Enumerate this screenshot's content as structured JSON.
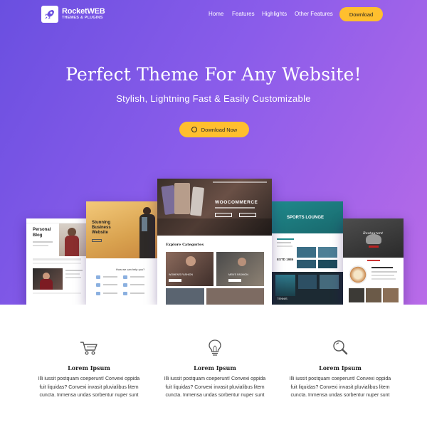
{
  "brand": {
    "name": "RocketWEB",
    "tagline": "THEMES & PLUGINS",
    "logo_icon": "rocket-icon"
  },
  "nav": {
    "items": [
      "Home",
      "Features",
      "Highlights",
      "Other Features"
    ],
    "cta_label": "Download"
  },
  "hero": {
    "title": "Perfect Theme For Any Website!",
    "subtitle": "Stylish, Lightning Fast & Easily Customizable",
    "cta_label": "Download Now",
    "cta_icon": "wordpress-icon"
  },
  "previews": {
    "personal": {
      "title_line1": "Personal",
      "title_line2": "Blog"
    },
    "business": {
      "title_line1": "Stunning",
      "title_line2": "Business",
      "title_line3": "Website",
      "help": "How we can help you?"
    },
    "woo": {
      "title": "WOOCOMMERCE",
      "section": "Explore Categories",
      "cat1": "WOMEN'S FASHION",
      "cat2": "MEN'S FASHION"
    },
    "sports": {
      "title": "SPORTS LOUNGE",
      "est": "ESTD 1986",
      "tennis": "TENNIS"
    },
    "restaurant": {
      "title": "Restaurant"
    }
  },
  "features": [
    {
      "icon": "shopping-cart-icon",
      "title": "Lorem Ipsum",
      "line1": "Illi iussit postquam coeperunt! Convexi oppida",
      "line2": "fuit liquidas? Convexi invasit pluvialibus litem",
      "line3": "cuncta. Inmensa undas sorbentur nuper sunt"
    },
    {
      "icon": "lightbulb-icon",
      "title": "Lorem Ipsum",
      "line1": "Illi iussit postquam coeperunt! Convexi oppida",
      "line2": "fuit liquidas? Convexi invasit pluvialibus litem",
      "line3": "cuncta. Inmensa undas sorbentur nuper sunt"
    },
    {
      "icon": "search-icon",
      "title": "Lorem Ipsum",
      "line1": "Illi iussit postquam coeperunt! Convexi oppida",
      "line2": "fuit liquidas? Convexi invasit pluvialibus litem",
      "line3": "cuncta. Inmensa undas sorbentur nuper sunt"
    }
  ],
  "colors": {
    "gradient_start": "#6a4fe0",
    "gradient_end": "#b96be8",
    "accent": "#ffbf2e"
  }
}
